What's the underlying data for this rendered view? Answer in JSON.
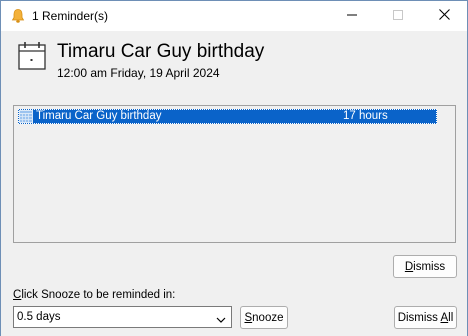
{
  "window": {
    "title": "1 Reminder(s)",
    "icon": "bell-icon",
    "accent_color": "#0a63c9",
    "border_color": "#6e8fb6"
  },
  "titlebar_buttons": {
    "minimize_icon": "minimize-icon",
    "maximize_icon": "maximize-icon",
    "close_icon": "close-icon"
  },
  "reminder": {
    "icon": "calendar-icon",
    "subject": "Timaru Car Guy birthday",
    "due": "12:00 am Friday, 19 April 2024"
  },
  "list": {
    "rows": [
      {
        "icon": "calendar-grid-icon",
        "subject": "Timaru Car Guy birthday",
        "due_in": "17 hours",
        "selected": true
      }
    ]
  },
  "buttons": {
    "dismiss_prefix": "",
    "dismiss_accel": "D",
    "dismiss_rest": "ismiss",
    "snooze_prefix": "",
    "snooze_accel": "S",
    "snooze_rest": "nooze",
    "dismiss_all_prefix": "Dismiss ",
    "dismiss_all_accel": "A",
    "dismiss_all_rest": "ll"
  },
  "snooze": {
    "label_accel": "C",
    "label_rest": "lick Snooze to be reminded in:",
    "selected_value": "0.5 days"
  }
}
